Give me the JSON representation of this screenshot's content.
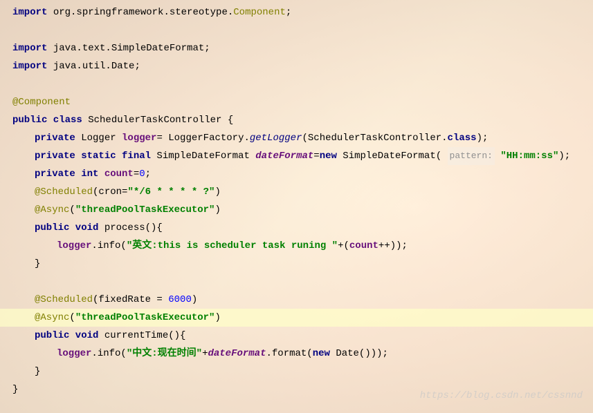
{
  "code": {
    "import1_kw": "import",
    "import1_pkg": " org.springframework.stereotype.",
    "import1_cls": "Component",
    "import1_semi": ";",
    "import2_kw": "import",
    "import2_pkg": " java.text.SimpleDateFormat;",
    "import3_kw": "import",
    "import3_pkg": " java.util.Date;",
    "ann_component": "@Component",
    "class_decl_kw1": "public class",
    "class_decl_name": " SchedulerTaskController {",
    "logger_kw": "private",
    "logger_type": " Logger ",
    "logger_field": "logger",
    "logger_assign": "= LoggerFactory.",
    "logger_method": "getLogger",
    "logger_args": "(SchedulerTaskController.",
    "logger_cls": "class",
    "logger_end": ");",
    "df_kw": "private static final",
    "df_type": " SimpleDateFormat ",
    "df_field": "dateFormat",
    "df_eq": "=",
    "df_new": "new",
    "df_ctor": " SimpleDateFormat( ",
    "df_hint": "pattern:",
    "df_str": " \"HH:mm:ss\"",
    "df_end": ");",
    "count_kw": "private int",
    "count_field": " count",
    "count_eq": "=",
    "count_val": "0",
    "count_semi": ";",
    "sched1_ann": "@Scheduled",
    "sched1_open": "(cron=",
    "sched1_str": "\"*/6 * * * * ?\"",
    "sched1_close": ")",
    "async1_ann": "@Async",
    "async1_open": "(",
    "async1_str": "\"threadPoolTaskExecutor\"",
    "async1_close": ")",
    "proc_kw": "public void",
    "proc_name": " process(){",
    "proc_log_field": "logger",
    "proc_log_call": ".info(",
    "proc_log_str": "\"英文:this is scheduler task runing \"",
    "proc_log_plus": "+(",
    "proc_log_cnt": "count",
    "proc_log_end": "++));",
    "close_brace": "}",
    "sched2_ann": "@Scheduled",
    "sched2_open": "(fixedRate = ",
    "sched2_val": "6000",
    "sched2_close": ")",
    "async2_ann": "@Async",
    "async2_open": "(",
    "async2_str": "\"threadPoolTaskExecutor\"",
    "async2_close": ")",
    "curr_kw": "public void",
    "curr_name": " currentTime(){",
    "curr_log_field": "logger",
    "curr_log_call": ".info(",
    "curr_log_str": "\"中文:现在时间\"",
    "curr_log_plus": "+",
    "curr_log_df": "dateFormat",
    "curr_log_fmt": ".format(",
    "curr_log_new": "new",
    "curr_log_date": " Date()));",
    "close_brace2": "}",
    "close_brace3": "}"
  },
  "watermark": "https://blog.csdn.net/cssnnd"
}
